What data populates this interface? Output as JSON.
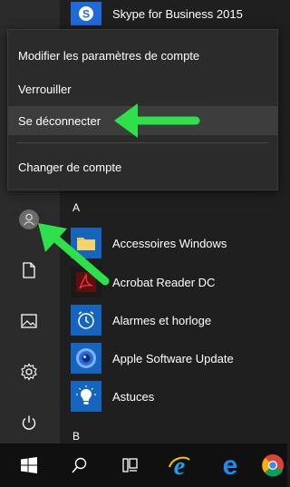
{
  "top_app": {
    "label": "Skype for Business 2015",
    "icon": "skype-icon",
    "color": "#1f6bd8"
  },
  "context_menu": {
    "items": [
      {
        "label": "Modifier les paramètres de compte"
      },
      {
        "label": "Verrouiller"
      },
      {
        "label": "Se déconnecter"
      },
      {
        "label": "Changer de compte"
      }
    ]
  },
  "app_list": {
    "group_a": "A",
    "group_b": "B",
    "apps": [
      {
        "label": "Accessoires Windows",
        "icon": "folder-icon",
        "color": "#1565c0"
      },
      {
        "label": "Acrobat Reader DC",
        "icon": "acrobat-icon",
        "color": "#1565c0"
      },
      {
        "label": "Alarmes et horloge",
        "icon": "alarm-clock-icon",
        "color": "#1565c0"
      },
      {
        "label": "Apple Software Update",
        "icon": "apple-update-icon",
        "color": "#1565c0"
      },
      {
        "label": "Astuces",
        "icon": "lightbulb-icon",
        "color": "#1565c0"
      }
    ]
  },
  "rail": [
    "user-avatar-icon",
    "document-icon",
    "pictures-icon",
    "settings-icon",
    "power-icon"
  ],
  "taskbar": [
    "windows-start-icon",
    "search-icon",
    "task-view-icon",
    "internet-explorer-icon",
    "edge-icon",
    "chrome-icon"
  ],
  "accent_arrow_color": "#2ee04a"
}
